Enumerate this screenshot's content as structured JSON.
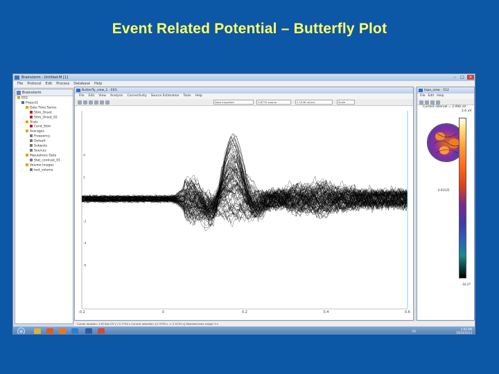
{
  "slide": {
    "title": "Event Related Potential – Butterfly Plot"
  },
  "app": {
    "title": "Brainstorm - Untitled-M [1]",
    "menu": [
      "File",
      "Protocol",
      "Edit",
      "Process",
      "Database",
      "Help"
    ]
  },
  "tree": {
    "header": "Brainstorm",
    "items": [
      {
        "label": "EEG",
        "indent": 0,
        "color": "#d8a800"
      },
      {
        "label": "Project1",
        "indent": 1,
        "color": "#3a6fbf"
      },
      {
        "label": "Data Time Series",
        "indent": 2,
        "color": "#d8a800"
      },
      {
        "label": "Stim_Onset",
        "indent": 3,
        "color": "#c02020"
      },
      {
        "label": "Stim_Onset_02",
        "indent": 3,
        "color": "#c02020"
      },
      {
        "label": "Trials",
        "indent": 2,
        "color": "#d8a800"
      },
      {
        "label": "Cond_Stim",
        "indent": 3,
        "color": "#c02020"
      },
      {
        "label": "Averages",
        "indent": 2,
        "color": "#d8a800"
      },
      {
        "label": "Frequency",
        "indent": 3,
        "color": "#777777"
      },
      {
        "label": "Default",
        "indent": 3,
        "color": "#777777"
      },
      {
        "label": "Subjects",
        "indent": 3,
        "color": "#777777"
      },
      {
        "label": "Sources",
        "indent": 3,
        "color": "#777777"
      },
      {
        "label": "Populations Data",
        "indent": 2,
        "color": "#d8a800"
      },
      {
        "label": "Stat_contrast_01",
        "indent": 3,
        "color": "#777777"
      },
      {
        "label": "Volume Images",
        "indent": 2,
        "color": "#d8a800"
      },
      {
        "label": "test_volume",
        "indent": 3,
        "color": "#777777"
      }
    ]
  },
  "figure": {
    "title": "Butterfly_view_1 - EEG",
    "menu": [
      "File",
      "Edit",
      "View",
      "Analysis",
      "Connectivity",
      "Source Estimation",
      "Tools",
      "Help"
    ],
    "toolbar_fields": [
      "Data Imported",
      "3.8770 source",
      "2.1526 uV/cm",
      "Scale"
    ],
    "status": "Cursor location: 2.8744e-03 V / 0.7734 s    Current selection: [2.3793 s -> 2.5723 s]  Selected time range: 0 s"
  },
  "topo": {
    "title": "topo_view - 512",
    "menu": [
      "File",
      "Edit",
      "Help"
    ],
    "info_label": "Current interval = 2.094 uV",
    "info_value": "2.6 uV",
    "mid_label": "0.01525",
    "min_label": "-16.27"
  },
  "taskbar": {
    "lang": "FR",
    "time": "2:00 PM",
    "date": "10/14/2013"
  },
  "chart_data": {
    "type": "line",
    "title": "",
    "xlabel": "",
    "ylabel": "",
    "x_ticks": [
      -0.2,
      0,
      0.2,
      0.4,
      0.6
    ],
    "xlim": [
      -0.2,
      0.6
    ],
    "ylim": [
      -10,
      8
    ],
    "y_ticks": [
      4,
      2,
      0,
      -2,
      -4,
      -6
    ],
    "cursor_x": 0.6,
    "n_channels": 90,
    "grid": false,
    "legend": "none"
  },
  "colors": {
    "slide_bg": "#0d57a7",
    "title": "#ffff66",
    "trace": "#000000",
    "cursor": "#7fd0f0"
  }
}
